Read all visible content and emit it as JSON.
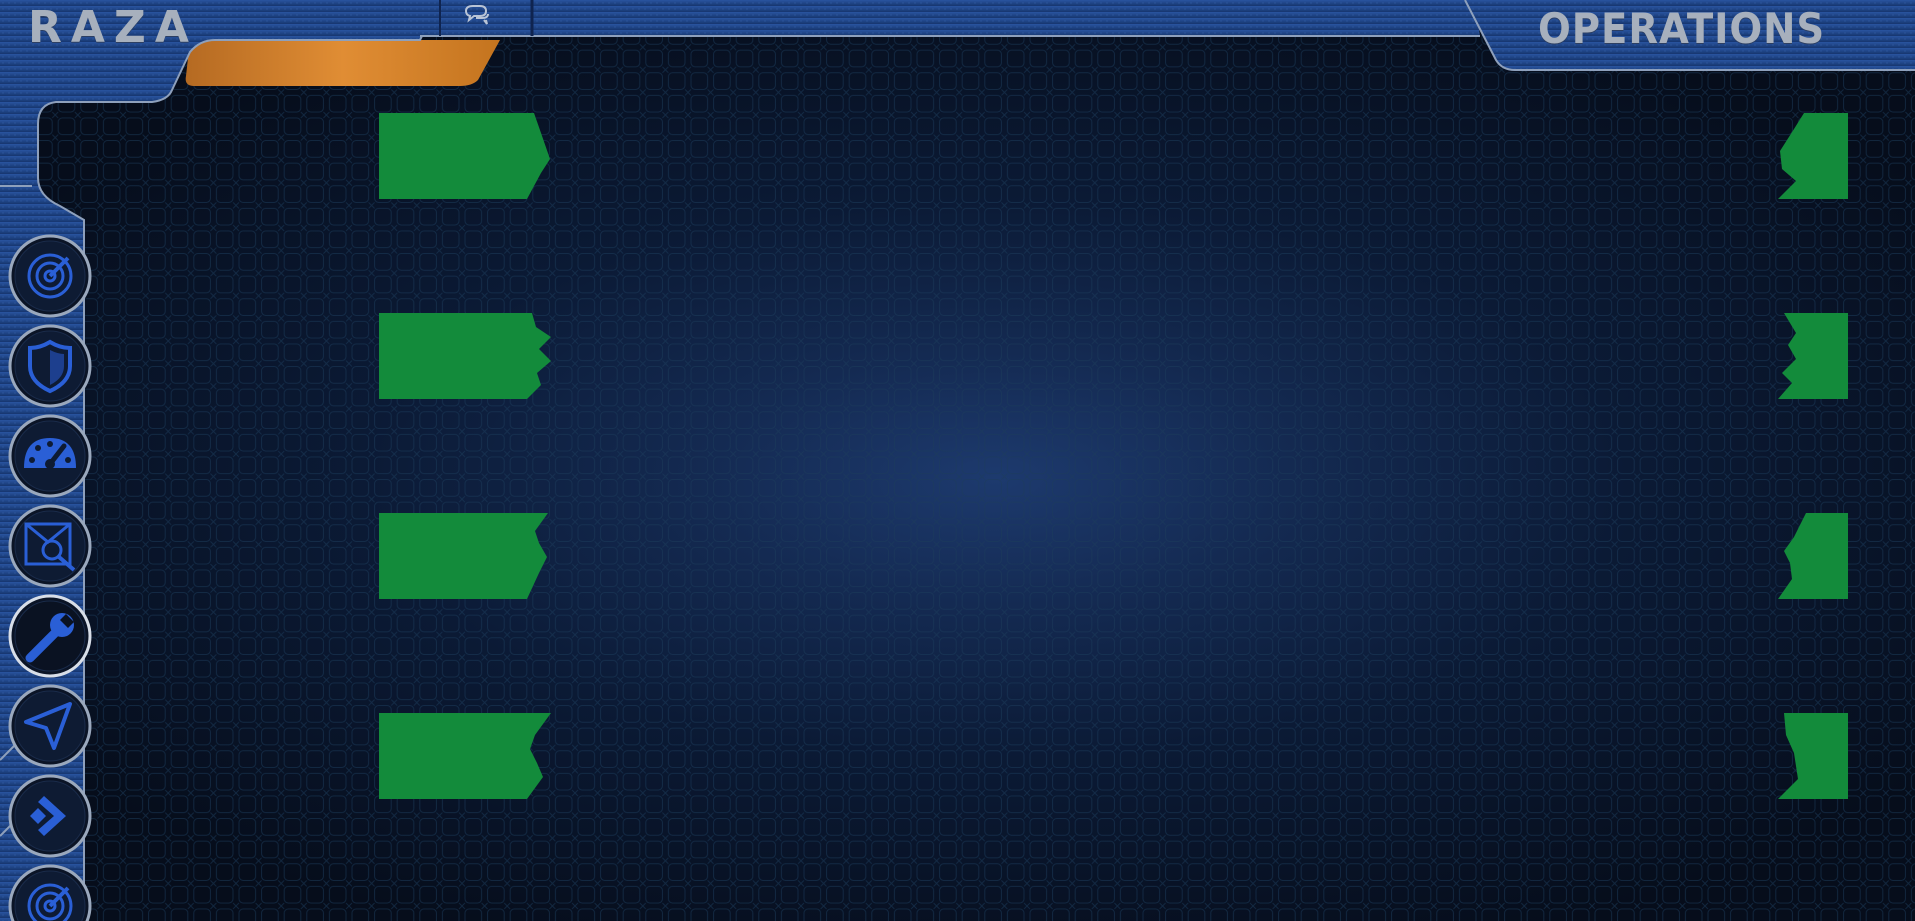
{
  "header": {
    "app_title": "RAZA",
    "screen_title": "OPERATIONS",
    "chat_icon": "chat-bubbles-icon"
  },
  "colors": {
    "panel_blue": "#1e4588",
    "panel_edge": "#8ea0bc",
    "accent_orange": "#d9822b",
    "slot_green": "#138b3b",
    "icon_blue": "#2a5fd6",
    "background_center": "#1d3a6e",
    "background_edge": "#060d1b"
  },
  "nav": {
    "active_item": "tool",
    "items": [
      {
        "id": "radar",
        "icon": "radar-icon",
        "active": false
      },
      {
        "id": "shield",
        "icon": "shield-icon",
        "active": false
      },
      {
        "id": "gauge",
        "icon": "speedometer-icon",
        "active": false
      },
      {
        "id": "inspect",
        "icon": "map-search-icon",
        "active": false
      },
      {
        "id": "tool",
        "icon": "wrench-icon",
        "active": true
      },
      {
        "id": "navigate",
        "icon": "navigation-arrow-icon",
        "active": false
      },
      {
        "id": "advance",
        "icon": "chevron-diamond-icon",
        "active": false
      },
      {
        "id": "radar-2",
        "icon": "radar-icon",
        "active": false
      }
    ]
  },
  "slots": {
    "left": [
      {
        "id": "left-1"
      },
      {
        "id": "left-2"
      },
      {
        "id": "left-3"
      },
      {
        "id": "left-4"
      }
    ],
    "right": [
      {
        "id": "right-1"
      },
      {
        "id": "right-2"
      },
      {
        "id": "right-3"
      },
      {
        "id": "right-4"
      }
    ]
  }
}
